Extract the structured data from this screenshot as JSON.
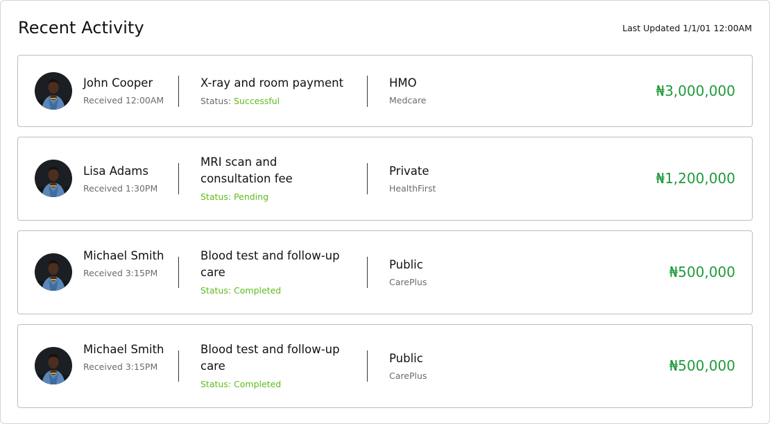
{
  "header": {
    "title": "Recent Activity",
    "last_updated": "Last Updated 1/1/01 12:00AM"
  },
  "colors": {
    "amount": "#1f9a3a",
    "status_green": "#5cbc18",
    "muted_text": "#6b6b6b",
    "border": "#bdbdbd"
  },
  "activities": [
    {
      "name": "John Cooper",
      "received": "Received 12:00AM",
      "description": "X-ray and room payment",
      "status_label": "Status:",
      "status_value": "Successful",
      "plan_type": "HMO",
      "provider": "Medcare",
      "amount": "₦3,000,000",
      "avatar_icon": "user-photo-avatar"
    },
    {
      "name": "Lisa Adams",
      "received": "Received 1:30PM",
      "description": "MRI scan and consultation fee",
      "status_label": "Status:",
      "status_value": "Pending",
      "plan_type": "Private",
      "provider": "HealthFirst",
      "amount": "₦1,200,000",
      "avatar_icon": "user-photo-avatar"
    },
    {
      "name": "Michael Smith",
      "received": "Received 3:15PM",
      "description": "Blood test and follow-up care",
      "status_label": "Status:",
      "status_value": "Completed",
      "plan_type": "Public",
      "provider": "CarePlus",
      "amount": "₦500,000",
      "avatar_icon": "user-photo-avatar"
    },
    {
      "name": "Michael Smith",
      "received": "Received 3:15PM",
      "description": "Blood test and follow-up care",
      "status_label": "Status:",
      "status_value": "Completed",
      "plan_type": "Public",
      "provider": "CarePlus",
      "amount": "₦500,000",
      "avatar_icon": "user-photo-avatar"
    }
  ]
}
